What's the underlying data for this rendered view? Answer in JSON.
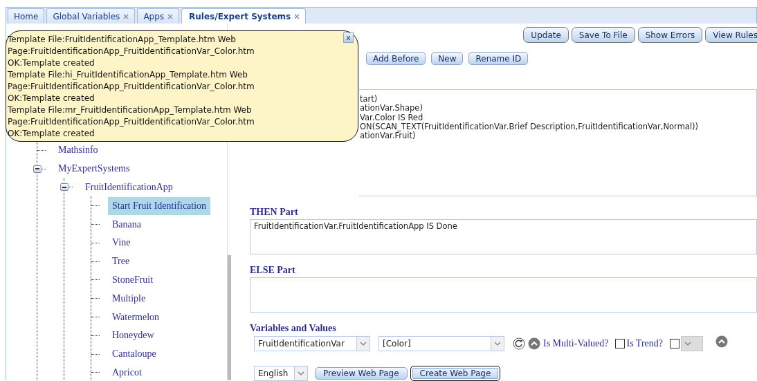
{
  "tabs": [
    {
      "label": "Home",
      "closable": false,
      "selected": false
    },
    {
      "label": "Global Variables",
      "closable": true,
      "selected": false
    },
    {
      "label": "Apps",
      "closable": true,
      "selected": false
    },
    {
      "label": "Rules/Expert Systems",
      "closable": true,
      "selected": true
    }
  ],
  "tree": [
    {
      "label": "Mathsinfo",
      "selected": false
    },
    {
      "label": "MyExpertSystems",
      "selected": false,
      "expanded": true,
      "children": [
        {
          "label": "FruitIdentificationApp",
          "selected": false,
          "expanded": true,
          "children": [
            {
              "label": "Start Fruit Identification",
              "selected": true
            },
            {
              "label": "Banana",
              "selected": false
            },
            {
              "label": "Vine",
              "selected": false
            },
            {
              "label": "Tree",
              "selected": false
            },
            {
              "label": "StoneFruit",
              "selected": false
            },
            {
              "label": "Multiple",
              "selected": false
            },
            {
              "label": "Watermelon",
              "selected": false
            },
            {
              "label": "Honeydew",
              "selected": false
            },
            {
              "label": "Cantaloupe",
              "selected": false
            },
            {
              "label": "Apricot",
              "selected": false
            }
          ]
        }
      ]
    }
  ],
  "toolbar_buttons": [
    {
      "label": "Update"
    },
    {
      "label": "Save To File"
    },
    {
      "label": "Show Errors"
    },
    {
      "label": "View Rules"
    }
  ],
  "edit_buttons": [
    {
      "label": "Add Before"
    },
    {
      "label": "New"
    },
    {
      "label": "Rename ID"
    }
  ],
  "if_part": {
    "lines": [
      "tart)",
      "ationVar.Shape)",
      "Var.Color IS Red",
      "ON(SCAN_TEXT(FruitIdentificationVar.Brief Description,FruitIdentificationVar,Normal))",
      "ationVar.Fruit)"
    ]
  },
  "then_part": {
    "label": "THEN Part",
    "text": "FruitIdentificationVar.FruitIdentificationApp IS Done"
  },
  "else_part": {
    "label": "ELSE Part"
  },
  "variables": {
    "label": "Variables and Values",
    "variable": "FruitIdentificationVar",
    "value": "[Color]",
    "multi_valued": {
      "label": "Is Multi-Valued?",
      "checked": false
    },
    "trend": {
      "label": "Is Trend?",
      "checked": false
    },
    "trend_select": {
      "disabled": true
    }
  },
  "language": "English",
  "page_buttons": [
    {
      "label": "Preview Web Page",
      "focused": false
    },
    {
      "label": "Create Web Page",
      "focused": true
    }
  ],
  "popup": {
    "lines": [
      "Template File:FruitIdentificationApp_Template.htm Web",
      "Page:FruitIdentificationApp_FruitIdentificationVar_Color.htm",
      "OK:Template created",
      "Template File:hi_FruitIdentificationApp_Template.htm Web",
      "Page:FruitIdentificationApp_FruitIdentificationVar_Color.htm",
      "OK:Template created",
      "Template File:mr_FruitIdentificationApp_Template.htm Web",
      "Page:FruitIdentificationApp_FruitIdentificationVar_Color.htm",
      "OK:Template created"
    ],
    "close": "x"
  }
}
